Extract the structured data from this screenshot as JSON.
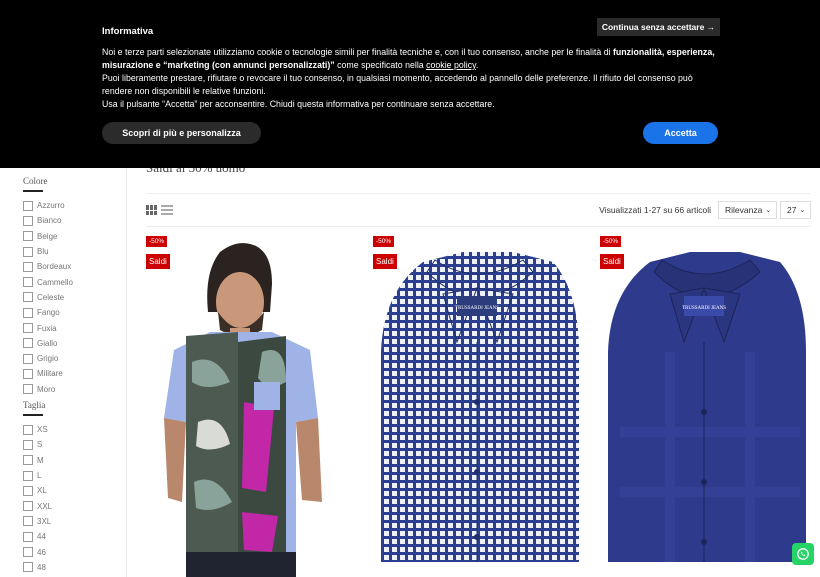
{
  "cookie_banner": {
    "title": "Informativa",
    "continue_label": "Continua senza accettare →",
    "line1_a": "Noi e terze parti selezionate utilizziamo cookie o tecnologie simili per finalità tecniche e, con il tuo consenso, anche per le finalità di ",
    "line1_b": "funzionalità, esperienza, misurazione e “marketing (con annunci personalizzati)”",
    "line1_c": " come specificato nella ",
    "cookie_policy_link": "cookie policy",
    "line1_d": ".",
    "line2": "Puoi liberamente prestare, rifiutare o revocare il tuo consenso, in qualsiasi momento, accedendo al pannello delle preferenze. Il rifiuto del consenso può rendere non disponibili le relative funzioni.",
    "line3": "Usa il pulsante “Accetta” per acconsentire. Chiudi questa informativa per continuare senza accettare.",
    "more_label": "Scopri di più e personalizza",
    "accept_label": "Accetta",
    "accept_color": "#1a73e8"
  },
  "page": {
    "title": "Saldi al 50% uomo"
  },
  "filters": {
    "colore_title": "Colore",
    "colori": [
      "Azzurro",
      "Bianco",
      "Beige",
      "Blu",
      "Bordeaux",
      "Cammello",
      "Celeste",
      "Fango",
      "Fuxia",
      "Giallo",
      "Grigio",
      "Militare",
      "Moro"
    ],
    "taglia_title": "Taglia",
    "taglie": [
      "XS",
      "S",
      "M",
      "L",
      "XL",
      "XXL",
      "3XL",
      "44",
      "46",
      "48"
    ]
  },
  "toolbar": {
    "results_text": "Visualizzati 1-27 su 66 articoli",
    "sort_label": "Rilevanza",
    "perpage_label": "27"
  },
  "products": [
    {
      "discount": "-50%",
      "sale": "Saldi"
    },
    {
      "discount": "-50%",
      "sale": "Saldi"
    },
    {
      "discount": "-50%",
      "sale": "Saldi"
    }
  ],
  "brand_label": "TRUSSARDI JEANS",
  "colors": {
    "sale_badge": "#cc0000",
    "whatsapp": "#25d366"
  }
}
